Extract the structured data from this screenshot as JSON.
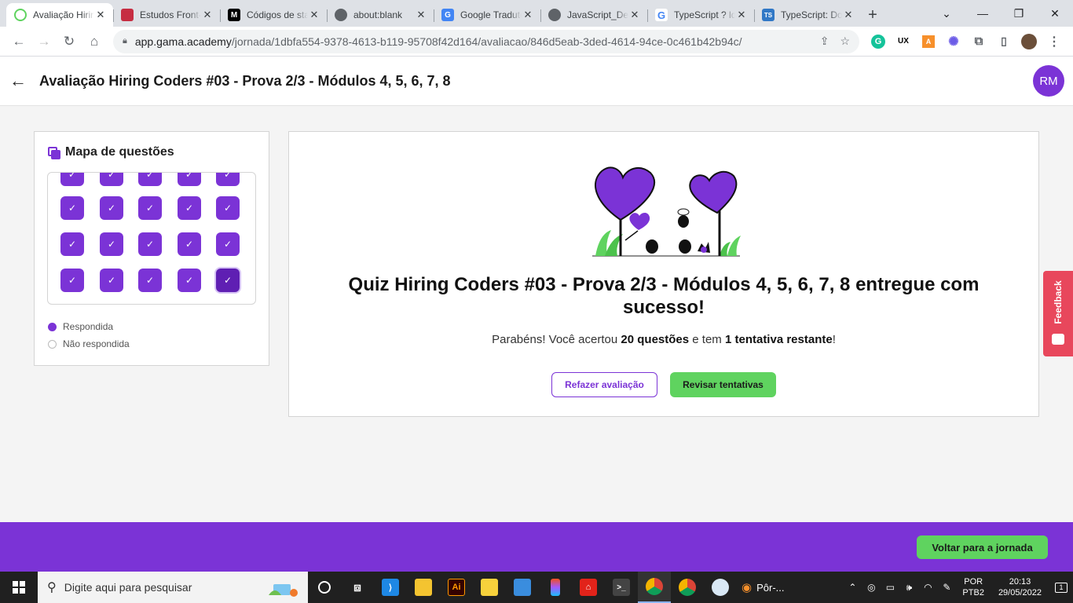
{
  "browser": {
    "tabs": [
      {
        "title": "Avaliação Hiring Coders",
        "icon": "gama-icon",
        "color": "#5fd35f",
        "active": true
      },
      {
        "title": "Estudos Front-end",
        "icon": "book-icon",
        "color": "#c62d42"
      },
      {
        "title": "Códigos de status",
        "icon": "mdn-icon",
        "color": "#000000"
      },
      {
        "title": "about:blank",
        "icon": "globe-icon",
        "color": "#5f6368"
      },
      {
        "title": "Google Tradutor",
        "icon": "translate-icon",
        "color": "#4285f4"
      },
      {
        "title": "JavaScript_Deep",
        "icon": "globe-icon",
        "color": "#5f6368"
      },
      {
        "title": "TypeScript ? ld",
        "icon": "google-icon",
        "color": "#4285f4"
      },
      {
        "title": "TypeScript: Do",
        "icon": "ts-icon",
        "color": "#3178c6"
      }
    ],
    "new_tab": "+",
    "url_host": "app.gama.academy",
    "url_path": "/jornada/1dbfa554-9378-4613-b119-95708f42d164/avaliacao/846d5eab-3ded-4614-94ce-0c461b42b94c/"
  },
  "header": {
    "title": "Avaliação Hiring Coders #03 - Prova 2/3 - Módulos 4, 5, 6, 7, 8",
    "avatar": "RM"
  },
  "question_map": {
    "title": "Mapa de questões",
    "legend_answered": "Respondida",
    "legend_unanswered": "Não respondida",
    "check": "✓"
  },
  "result": {
    "title": "Quiz Hiring Coders #03 - Prova 2/3 - Módulos 4, 5, 6, 7, 8 entregue com sucesso!",
    "sub_pre": "Parabéns! Você acertou ",
    "sub_score": "20 questões",
    "sub_mid": " e tem ",
    "sub_attempts": "1 tentativa restante",
    "sub_end": "!",
    "redo_button": "Refazer avaliação",
    "review_button": "Revisar tentativas"
  },
  "feedback": {
    "label": "Feedback"
  },
  "footer": {
    "back_button": "Voltar para a jornada"
  },
  "taskbar": {
    "search_placeholder": "Digite aqui para pesquisar",
    "weather": "Pôr-...",
    "lang_line1": "POR",
    "lang_line2": "PTB2",
    "time": "20:13",
    "date": "29/05/2022",
    "notifications": "1"
  },
  "colors": {
    "brand_purple": "#7b33d6",
    "success_green": "#5fd35f",
    "feedback_red": "#e8475c"
  }
}
